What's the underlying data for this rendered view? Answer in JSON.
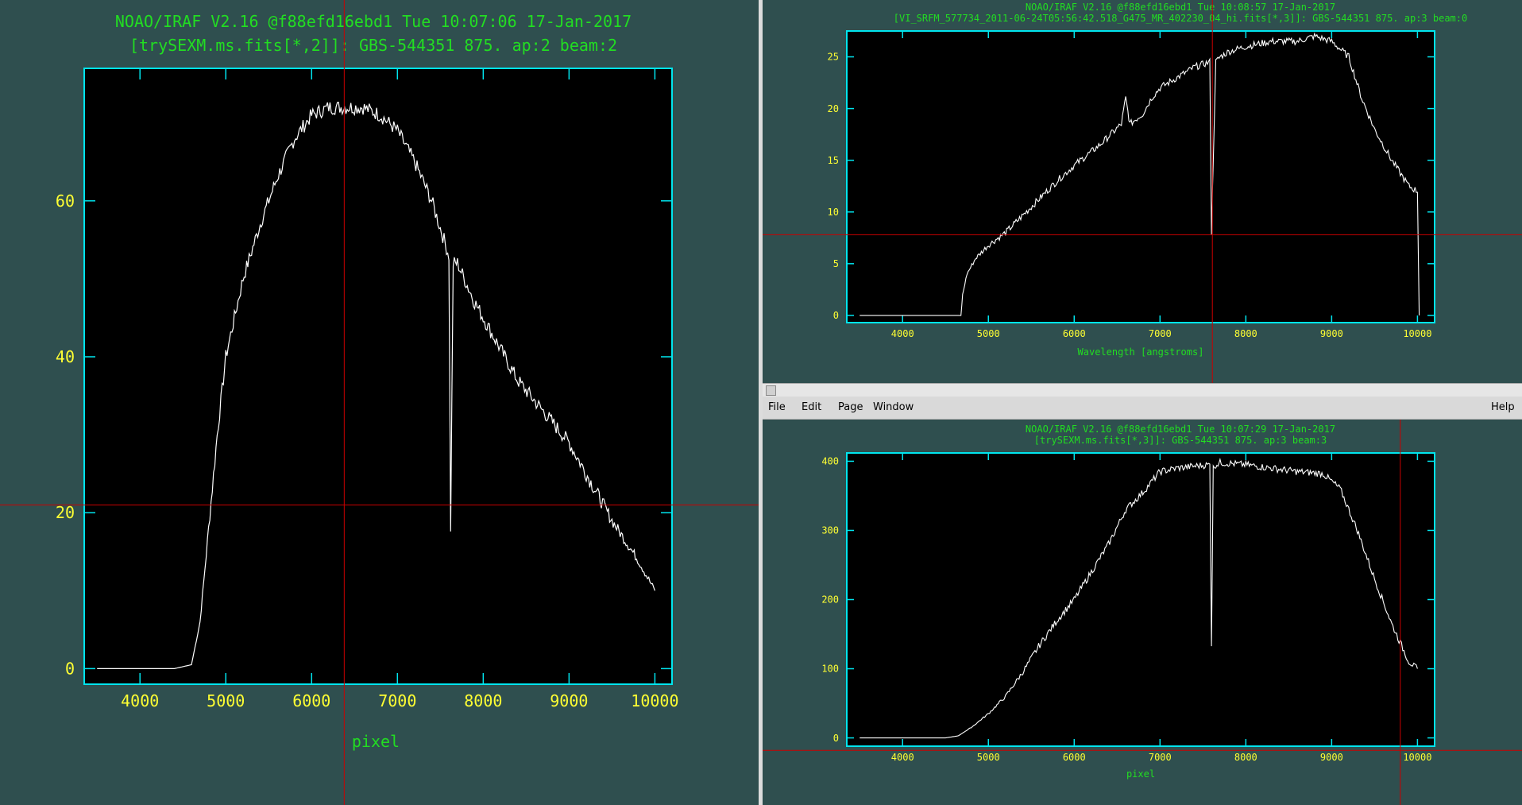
{
  "left": {
    "title": "NOAO/IRAF V2.16 @f88efd16ebd1 Tue 10:07:06 17-Jan-2017",
    "subtitle": "[trySEXM.ms.fits[*,2]]: GBS-544351 875. ap:2 beam:2",
    "xlabel": "pixel",
    "ylabel": ""
  },
  "top_right": {
    "title": "NOAO/IRAF V2.16 @f88efd16ebd1 Tue 10:08:57 17-Jan-2017",
    "subtitle": "[VI_SRFM_577734_2011-06-24T05:56:42.518_G475_MR_402230_04_hi.fits[*,3]]: GBS-544351 875. ap:3 beam:0",
    "xlabel": "Wavelength [angstroms]",
    "ylabel": ""
  },
  "bottom_right": {
    "title": "NOAO/IRAF V2.16 @f88efd16ebd1 Tue 10:07:29 17-Jan-2017",
    "subtitle": "[trySEXM.ms.fits[*,3]]: GBS-544351 875. ap:3 beam:3",
    "xlabel": "pixel",
    "ylabel": ""
  },
  "menu": {
    "file": "File",
    "edit": "Edit",
    "page": "Page",
    "window": "Window",
    "help": "Help"
  },
  "colors": {
    "background": "#2f4f4f",
    "frame": "#00e5ee",
    "text": "#ffff33",
    "title": "#22dd22",
    "trace": "#ffffff",
    "cursor": "#cc0000",
    "plot_bg": "#000000"
  },
  "chart_data": [
    {
      "type": "line",
      "id": "left",
      "title": "NOAO/IRAF V2.16 @f88efd16ebd1 Tue 10:07:06 17-Jan-2017",
      "xlabel": "pixel",
      "ylabel": "",
      "xlim": [
        3350,
        10200
      ],
      "ylim": [
        -2,
        77
      ],
      "xticks": [
        4000,
        5000,
        6000,
        7000,
        8000,
        9000,
        10000
      ],
      "yticks": [
        0,
        20,
        40,
        60
      ],
      "cursor": {
        "x": 6380,
        "y": 21
      },
      "series": [
        {
          "x": [
            3500,
            4400,
            4600,
            4700,
            4800,
            4900,
            5000,
            5200,
            5400,
            5600,
            5800,
            6000,
            6200,
            6400,
            6600,
            6800,
            7000,
            7200,
            7400,
            7600,
            7620,
            7650,
            7700,
            7900,
            8100,
            8400,
            8700,
            9000,
            9200,
            9500,
            9800,
            10000
          ],
          "y": [
            0,
            0,
            0.5,
            6,
            18,
            30,
            40,
            50,
            57,
            63,
            68,
            71,
            72,
            72,
            72,
            71,
            69,
            65,
            60,
            53,
            18,
            52,
            52,
            47,
            43,
            37,
            33,
            29,
            25,
            19,
            14,
            10
          ]
        }
      ]
    },
    {
      "type": "line",
      "id": "top_right",
      "title": "NOAO/IRAF V2.16 @f88efd16ebd1 Tue 10:08:57 17-Jan-2017",
      "xlabel": "Wavelength [angstroms]",
      "ylabel": "",
      "xlim": [
        3350,
        10200
      ],
      "ylim": [
        -0.7,
        27.5
      ],
      "xticks": [
        4000,
        5000,
        6000,
        7000,
        8000,
        9000,
        10000
      ],
      "yticks": [
        0,
        5,
        10,
        15,
        20,
        25
      ],
      "cursor": {
        "x": 7610,
        "y": 7.8
      },
      "series": [
        {
          "x": [
            3500,
            4680,
            4700,
            4750,
            4850,
            5000,
            5200,
            5500,
            5800,
            6000,
            6300,
            6550,
            6600,
            6650,
            6800,
            6900,
            7000,
            7200,
            7400,
            7580,
            7600,
            7620,
            7650,
            7700,
            7800,
            8000,
            8300,
            8600,
            8800,
            9000,
            9200,
            9350,
            9500,
            9700,
            9900,
            10000,
            10020
          ],
          "y": [
            0,
            0,
            2,
            4,
            5.5,
            6.8,
            8,
            10.5,
            13,
            14.5,
            16.5,
            18.5,
            21,
            18.5,
            19.5,
            21,
            22,
            23,
            24,
            24.5,
            8,
            15,
            24.5,
            25,
            25.5,
            26,
            26.5,
            26.5,
            27,
            26.5,
            25,
            21,
            18,
            15,
            12.5,
            12,
            0
          ]
        }
      ]
    },
    {
      "type": "line",
      "id": "bottom_right",
      "title": "NOAO/IRAF V2.16 @f88efd16ebd1 Tue 10:07:29 17-Jan-2017",
      "xlabel": "pixel",
      "ylabel": "",
      "xlim": [
        3350,
        10200
      ],
      "ylim": [
        -12,
        412
      ],
      "xticks": [
        4000,
        5000,
        6000,
        7000,
        8000,
        9000,
        10000
      ],
      "yticks": [
        0,
        100,
        200,
        300,
        400
      ],
      "cursor": {
        "x": 9800,
        "y": -18
      },
      "series": [
        {
          "x": [
            3500,
            4500,
            4650,
            4800,
            5000,
            5200,
            5400,
            5600,
            5800,
            6000,
            6200,
            6400,
            6600,
            6800,
            7000,
            7200,
            7400,
            7580,
            7600,
            7620,
            7650,
            7700,
            8000,
            8300,
            8600,
            8900,
            9100,
            9300,
            9500,
            9700,
            9900,
            10000
          ],
          "y": [
            0,
            0,
            3,
            15,
            35,
            60,
            95,
            135,
            170,
            200,
            240,
            280,
            330,
            355,
            385,
            390,
            393,
            395,
            135,
            390,
            395,
            398,
            395,
            390,
            385,
            382,
            360,
            300,
            230,
            165,
            110,
            100
          ]
        }
      ]
    }
  ]
}
